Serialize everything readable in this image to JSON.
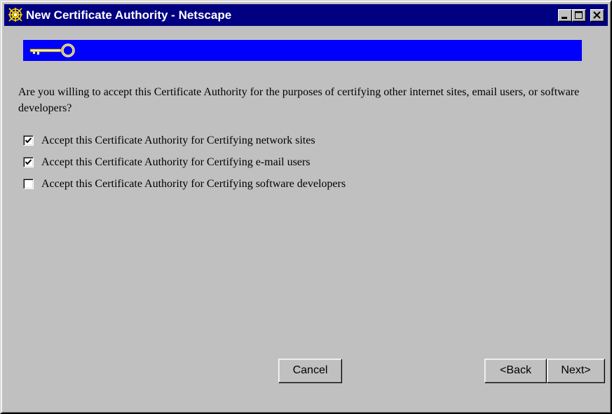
{
  "window": {
    "title": "New Certificate Authority - Netscape"
  },
  "colors": {
    "titlebar": "#000080",
    "banner": "#0000ff",
    "face": "#c0c0c0"
  },
  "icons": {
    "title": "netscape-spider-icon",
    "banner": "key-icon"
  },
  "main": {
    "question": "Are you willing to accept this Certificate Authority for the purposes of certifying other internet sites, email users, or software developers?",
    "options": [
      {
        "label": "Accept this Certificate Authority for Certifying network sites",
        "checked": true
      },
      {
        "label": "Accept this Certificate Authority for Certifying e-mail users",
        "checked": true
      },
      {
        "label": "Accept this Certificate Authority for Certifying software developers",
        "checked": false
      }
    ]
  },
  "buttons": {
    "cancel": "Cancel",
    "back": "<Back",
    "next": "Next>"
  }
}
